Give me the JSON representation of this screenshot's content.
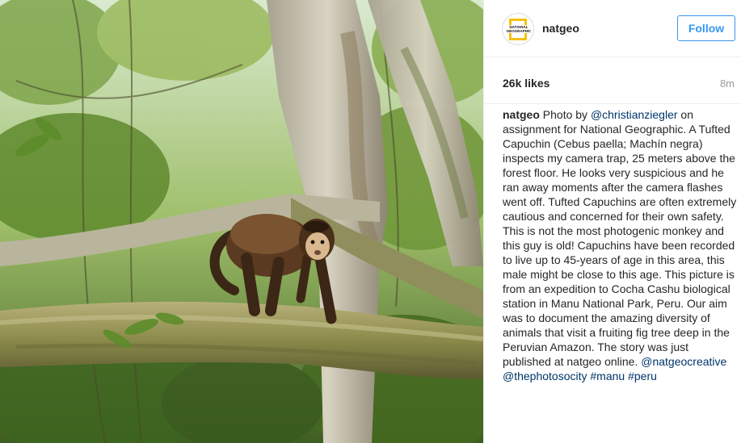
{
  "post": {
    "image_alt": "Tufted capuchin monkey on a mossy branch",
    "colors": {
      "link": "#003569",
      "follow": "#3897f0",
      "text": "#262626",
      "muted": "#999999"
    }
  },
  "header": {
    "avatar_text": "NATIONAL GEOGRAPHIC",
    "username": "natgeo",
    "follow_label": "Follow"
  },
  "stats": {
    "likes": "26k likes",
    "time": "8m"
  },
  "caption": {
    "author": "natgeo",
    "text_1": " Photo by ",
    "mention_1": "@christianziegler",
    "text_2": " on assignment for National Geographic. A Tufted Capuchin (Cebus paella; Machín negra) inspects my camera trap, 25 meters above the forest floor. He looks very suspicious and he ran away moments after the camera flashes went off. Tufted Capuchins are often extremely cautious and concerned for their own safety. This is not the most photogenic monkey and this guy is old! Capuchins have been recorded to live up to 45-years of age in this area, this male might be close to this age. This picture is from an expedition to Cocha Cashu biological station in Manu National Park, Peru. Our aim was to document the amazing diversity of animals that visit a fruiting fig tree deep in the Peruvian Amazon. The story was just published at natgeo online. ",
    "mention_2": "@natgeocreative",
    "mention_3": "@thephotosocity",
    "hashtag_1": "#manu",
    "hashtag_2": "#peru"
  }
}
